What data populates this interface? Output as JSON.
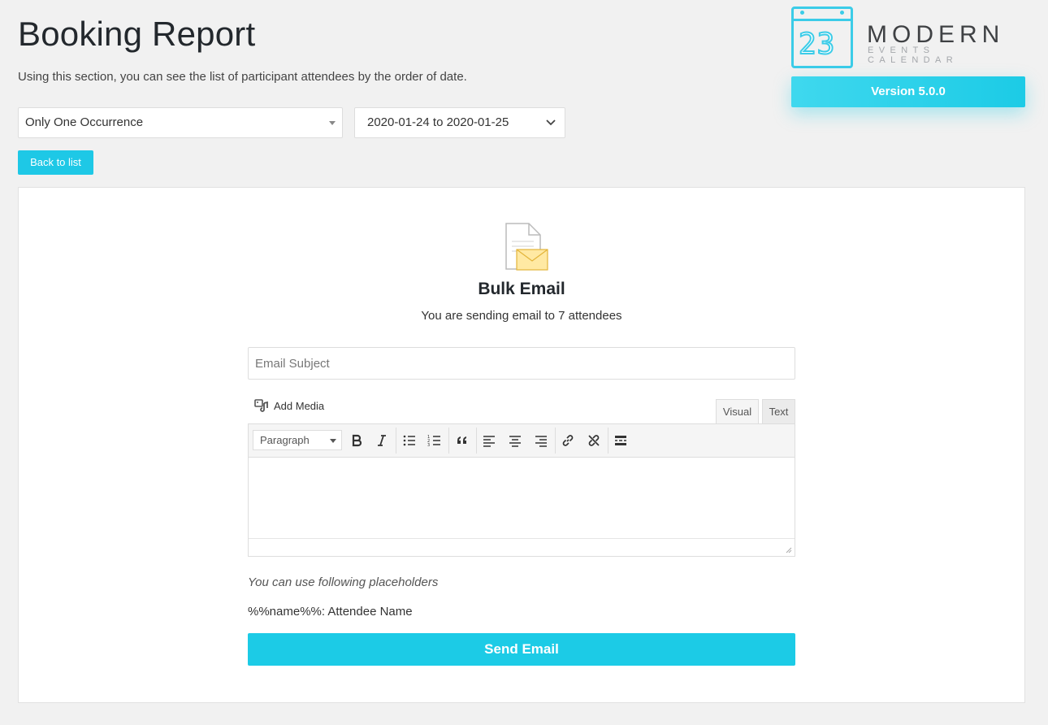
{
  "header": {
    "title": "Booking Report",
    "description": "Using this section, you can see the list of participant attendees by the order of date."
  },
  "logo": {
    "number": "23",
    "title": "MODERN",
    "subtitle": "EVENTS CALENDAR",
    "version": "Version 5.0.0"
  },
  "filters": {
    "occurrence_value": "Only One Occurrence",
    "date_range_value": "2020-01-24 to 2020-01-25"
  },
  "actions": {
    "back_label": "Back to list"
  },
  "bulk_email": {
    "title": "Bulk Email",
    "subtitle": "You are sending email to 7 attendees",
    "subject_placeholder": "Email Subject",
    "add_media_label": "Add Media",
    "tabs": {
      "visual": "Visual",
      "text": "Text"
    },
    "format_select": "Paragraph",
    "toolbar_icons": [
      "bold-icon",
      "italic-icon",
      "bullet-list-icon",
      "numbered-list-icon",
      "blockquote-icon",
      "align-left-icon",
      "align-center-icon",
      "align-right-icon",
      "link-icon",
      "unlink-icon",
      "read-more-icon"
    ],
    "placeholders_note": "You can use following placeholders",
    "placeholder_item": "%%name%%: Attendee Name",
    "send_label": "Send Email"
  },
  "colors": {
    "accent": "#1ccbe6",
    "background": "#f1f1f1",
    "logo_blue": "#3bcce8"
  }
}
